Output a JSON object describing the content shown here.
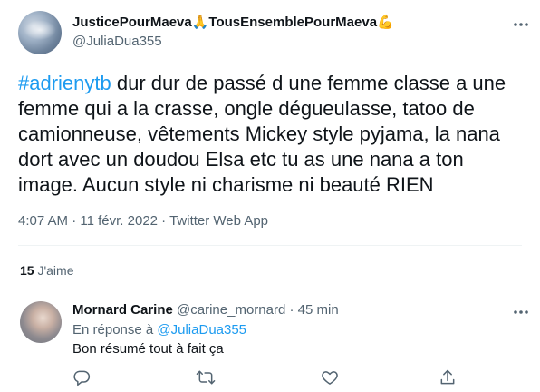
{
  "tweet": {
    "display_name_part1": "JusticePourMaeva",
    "emoji1": "🙏",
    "display_name_part2": "TousEnsemblePourMaeva",
    "emoji2": "💪",
    "handle": "@JuliaDua355",
    "hashtag": "#adrienytb",
    "text": " dur dur de passé d une femme classe a une femme qui a la crasse, ongle dégueulasse, tatoo de camionneuse, vêtements Mickey style pyjama, la nana dort avec un doudou Elsa etc tu as une nana a ton image. Aucun style ni charisme ni beauté RIEN",
    "time": "4:07 AM",
    "separator": " · ",
    "date": "11 févr. 2022",
    "source": "Twitter Web App",
    "likes_count": "15",
    "likes_label": " J'aime"
  },
  "reply": {
    "display_name": "Mornard Carine",
    "handle": "@carine_mornard",
    "separator": " · ",
    "time": "45 min",
    "reply_prefix": "En réponse à ",
    "reply_to": "@JuliaDua355",
    "text": "Bon résumé tout à fait ça"
  },
  "icons": {
    "more": "more-horizontal-icon",
    "reply": "reply-icon",
    "retweet": "retweet-icon",
    "like": "like-icon",
    "share": "share-icon"
  },
  "colors": {
    "accent": "#1d9bf0",
    "secondary_text": "#536471",
    "primary_text": "#0f1419",
    "divider": "#eff3f4"
  }
}
